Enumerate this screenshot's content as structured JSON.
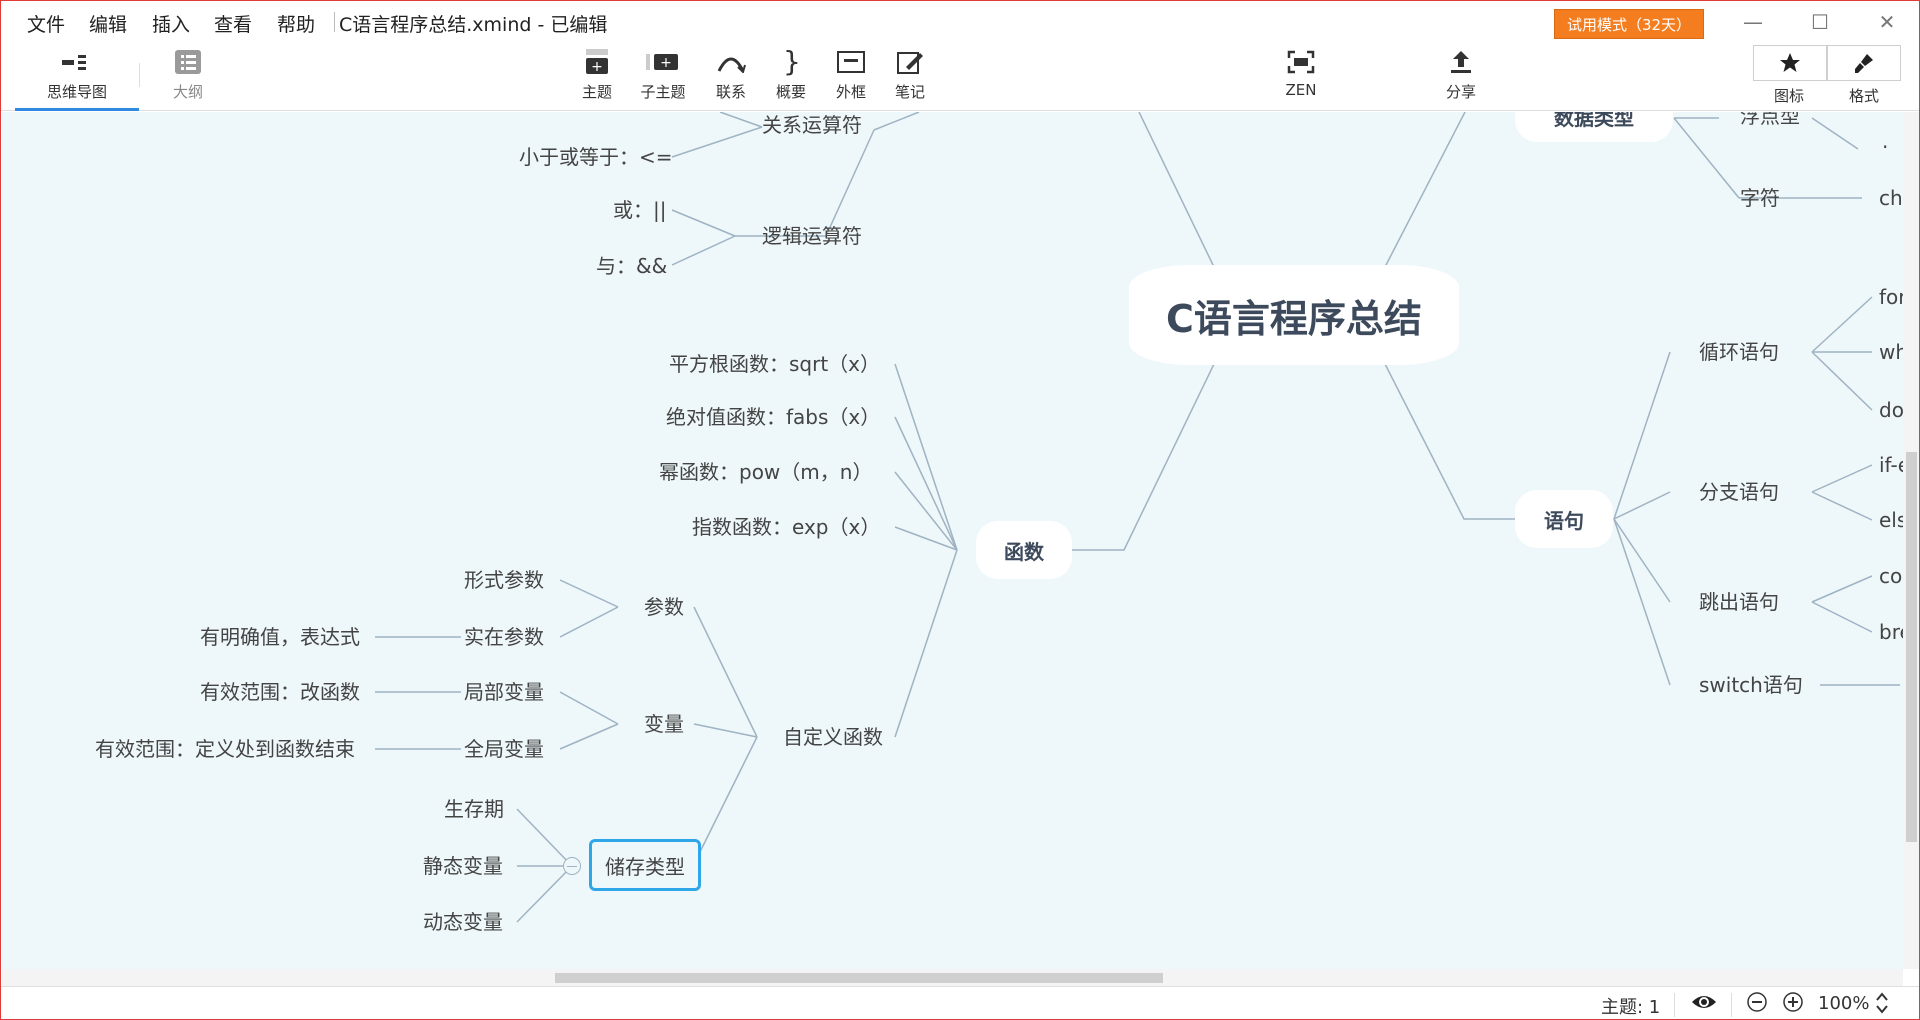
{
  "menu": {
    "file": "文件",
    "edit": "编辑",
    "insert": "插入",
    "view": "查看",
    "help": "帮助"
  },
  "document_title": "C语言程序总结.xmind - 已编辑",
  "trial_badge": "试用模式（32天）",
  "window_controls": {
    "minimize": "—",
    "maximize": "☐",
    "close": "✕"
  },
  "view_tabs": {
    "mindmap": "思维导图",
    "outline": "大纲"
  },
  "toolbar": {
    "topic": "主题",
    "subtopic": "子主题",
    "relationship": "联系",
    "summary": "概要",
    "boundary": "外框",
    "notes": "笔记",
    "zen": "ZEN",
    "share": "分享",
    "icons": "图标",
    "format": "格式"
  },
  "mindmap": {
    "central": "C语言程序总结",
    "topics": {
      "functions": "函数",
      "statements": "语句",
      "data_types": "数据类型"
    },
    "operators": {
      "relational": "关系运算符",
      "relational_items": [
        "小于或等于：<="
      ],
      "logical": "逻辑运算符",
      "logical_items": [
        "或：||",
        "与：&&"
      ]
    },
    "functions": {
      "builtins": [
        "平方根函数：sqrt（x）",
        "绝对值函数：fabs（x）",
        "幂函数：pow（m，n）",
        "指数函数：exp（x）"
      ],
      "custom": "自定义函数",
      "params": "参数",
      "formal_param": "形式参数",
      "actual_param": "实在参数",
      "actual_param_note": "有明确值，表达式",
      "variables": "变量",
      "local_var": "局部变量",
      "local_var_note": "有效范围：改函数",
      "global_var": "全局变量",
      "global_var_note": "有效范围：定义处到函数结束",
      "storage": "储存类型",
      "storage_items": [
        "生存期",
        "静态变量",
        "动态变量"
      ]
    },
    "data_types": {
      "float": "浮点型",
      "char": "字符",
      "char_child": "ch",
      "float_child": "·"
    },
    "statements": {
      "loop": "循环语句",
      "loop_items": [
        "for",
        "wh",
        "do"
      ],
      "branch": "分支语句",
      "branch_items": [
        "if-e",
        "els"
      ],
      "jump": "跳出语句",
      "jump_items": [
        "co",
        "bre"
      ],
      "switch": "switch语句"
    }
  },
  "status": {
    "topics": "主题: 1",
    "zoom": "100%"
  },
  "colors": {
    "accent": "#2f8ae0",
    "trial": "#f37d1f",
    "canvas": "#eef7fa",
    "line": "#9fb3c3",
    "selected_border": "#2fa6e8"
  }
}
